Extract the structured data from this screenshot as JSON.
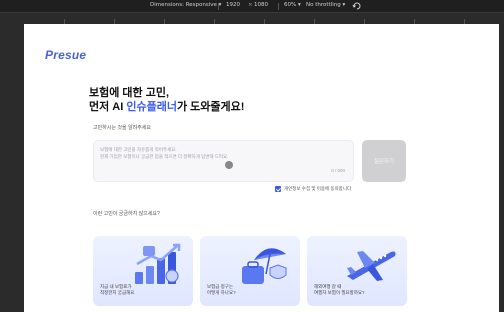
{
  "toolbar": {
    "dimensions_label": "Dimensions: Responsive ▾",
    "width": "1920",
    "times": "×",
    "height": "1080",
    "zoom": "60% ▾",
    "throttle": "No throttling ▾",
    "rotate_icon": "rotate-icon"
  },
  "brand": {
    "logo": "Presue",
    "accent_color": "#3a5bf0"
  },
  "hero": {
    "line1": "보험에 대한 고민,",
    "line2_prefix": "먼저 AI ",
    "line2_accent": "인슈플래너",
    "line2_suffix": "가 도와줄게요!"
  },
  "question": {
    "label": "고민하시는 것을 알려주세요",
    "placeholder": "보험에 대한 고민을 자유롭게 적어주세요.\n현재 가입한 보험이나 궁금한 점을 적으면 더 정확하게 답변해 드려요.",
    "counter": "0 / 500",
    "submit_label": "질문하기"
  },
  "consent": {
    "checked": true,
    "text": "개인정보 수집 및 이용에 동의합니다"
  },
  "examples": {
    "label": "이런 고민이 궁금하지 않으세요?",
    "cards": [
      {
        "text": "지금 내 보험료가\n적정한지 궁금해요",
        "icon": "chart-growth-icon"
      },
      {
        "text": "보험금 청구는\n어떻게 하나요?",
        "icon": "umbrella-bag-icon"
      },
      {
        "text": "해외여행 갈 때\n여행자 보험이 필요할까요?",
        "icon": "airplane-icon"
      }
    ]
  }
}
